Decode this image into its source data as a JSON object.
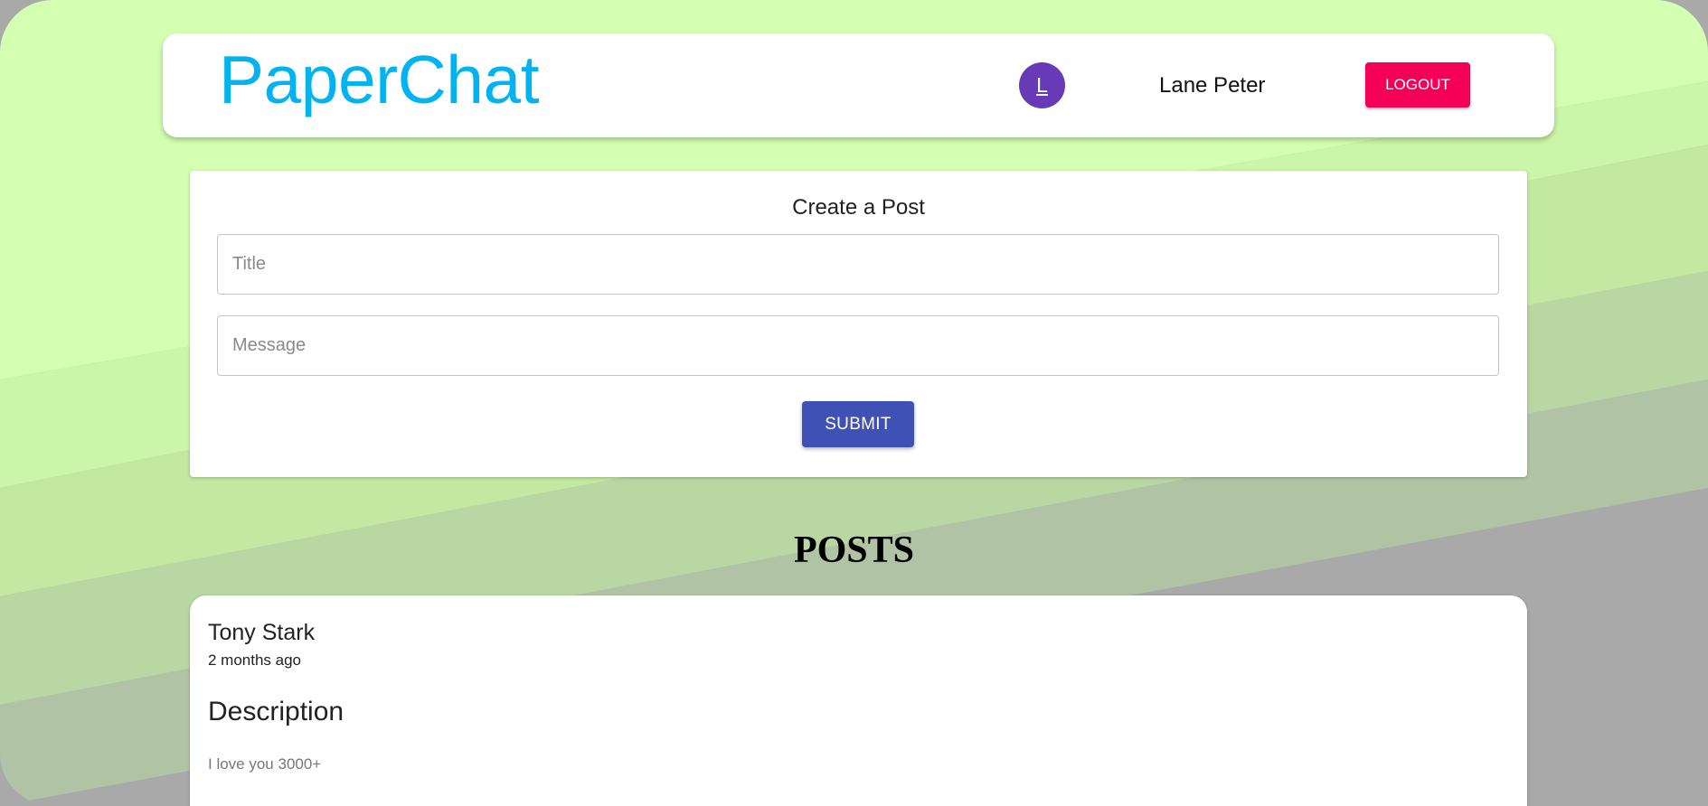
{
  "header": {
    "brand": "PaperChat",
    "avatar_initial": "L",
    "user_name": "Lane Peter",
    "logout_label": "LOGOUT"
  },
  "create_post": {
    "heading": "Create a Post",
    "title_placeholder": "Title",
    "message_placeholder": "Message",
    "submit_label": "SUBMIT"
  },
  "posts_heading": "POSTS",
  "posts": [
    {
      "author": "Tony Stark",
      "time": "2 months ago",
      "title": "Description",
      "message": "I love you 3000+"
    }
  ],
  "colors": {
    "brand": "#03b3f0",
    "avatar": "#673ab7",
    "logout": "#f50057",
    "submit": "#3f51b5"
  }
}
